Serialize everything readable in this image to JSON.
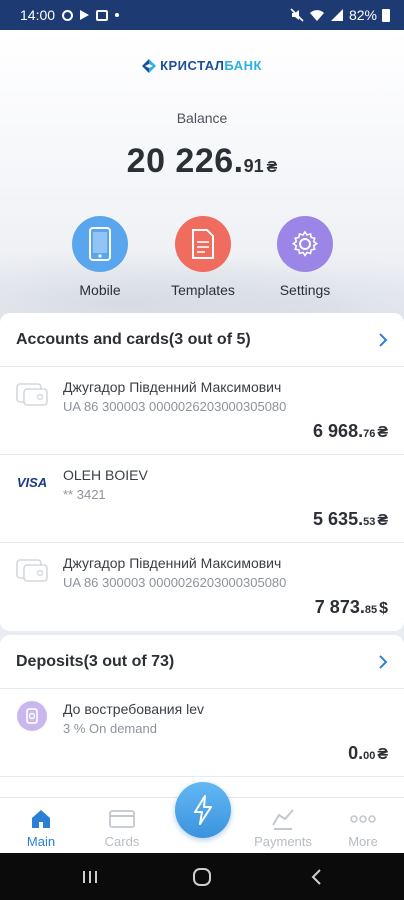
{
  "status_bar": {
    "time": "14:00",
    "battery": "82%"
  },
  "logo": {
    "part1": "КРИСТАЛ",
    "part2": "БАНК"
  },
  "balance": {
    "label": "Balance",
    "main": "20 226.",
    "cents": "91",
    "currency": "₴"
  },
  "quick_actions": [
    {
      "label": "Mobile",
      "icon": "mobile-phone-icon",
      "color": "#5aa6ee"
    },
    {
      "label": "Templates",
      "icon": "document-icon",
      "color": "#ef6c5e"
    },
    {
      "label": "Settings",
      "icon": "gear-icon",
      "color": "#9b86e8"
    }
  ],
  "accounts": {
    "title": "Accounts and cards(3 out of 5)",
    "items": [
      {
        "name": "Джугадор Південний Максимович",
        "sub": "UA 86 300003 0000026203000305080",
        "main": "6 968.",
        "cents": "76",
        "currency": "₴",
        "icon": "account-card-icon"
      },
      {
        "name": "OLEH BOIEV",
        "sub": "** 3421",
        "main": "5 635.",
        "cents": "53",
        "currency": "₴",
        "icon": "visa-icon",
        "icon_text": "VISA"
      },
      {
        "name": "Джугадор Південний Максимович",
        "sub": "UA 86 300003 0000026203000305080",
        "main": "7 873.",
        "cents": "85",
        "currency": "$",
        "icon": "account-card-icon"
      }
    ]
  },
  "deposits": {
    "title": "Deposits(3 out of 73)",
    "items": [
      {
        "name": "До востребования lev",
        "sub": "3 % On demand",
        "main": "0.",
        "cents": "00",
        "currency": "₴",
        "icon": "deposit-icon"
      }
    ]
  },
  "bottom_nav": [
    {
      "label": "Main",
      "icon": "home-icon",
      "active": true
    },
    {
      "label": "Cards",
      "icon": "card-icon",
      "active": false
    },
    {
      "label": "Payments",
      "icon": "payments-icon",
      "active": false
    },
    {
      "label": "More",
      "icon": "more-icon",
      "active": false
    }
  ],
  "colors": {
    "accent": "#2b7fd4",
    "status_bar": "#1d3b72",
    "fab": "#4aa3ea"
  }
}
